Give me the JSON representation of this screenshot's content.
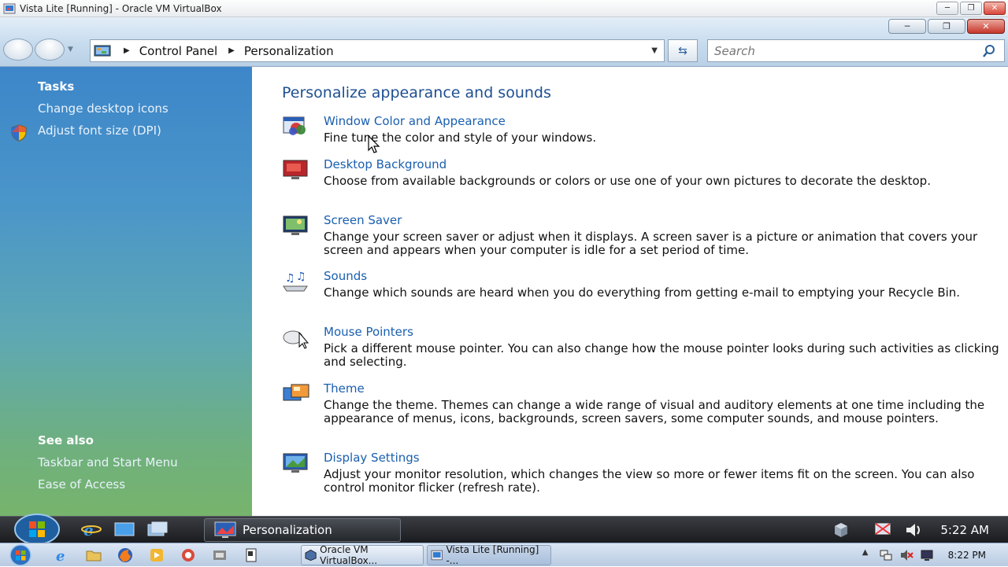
{
  "host": {
    "title": "Vista Lite [Running] - Oracle VM VirtualBox",
    "buttons": [
      "minimize",
      "restore",
      "close"
    ]
  },
  "toolbar": {
    "breadcrumb": [
      "Control Panel",
      "Personalization"
    ],
    "search_placeholder": "Search"
  },
  "sidebar": {
    "tasks_heading": "Tasks",
    "tasks": [
      {
        "label": "Change desktop icons"
      },
      {
        "label": "Adjust font size (DPI)"
      }
    ],
    "see_also_heading": "See also",
    "see_also": [
      {
        "label": "Taskbar and Start Menu"
      },
      {
        "label": "Ease of Access"
      }
    ]
  },
  "main": {
    "title": "Personalize appearance and sounds",
    "items": [
      {
        "icon": "window-color-icon",
        "title": "Window Color and Appearance",
        "desc": "Fine tune the color and style of your windows."
      },
      {
        "icon": "desktop-background-icon",
        "title": "Desktop Background",
        "desc": "Choose from available backgrounds or colors or use one of your own pictures to decorate the desktop."
      },
      {
        "icon": "screen-saver-icon",
        "title": "Screen Saver",
        "desc": "Change your screen saver or adjust when it displays. A screen saver is a picture or animation that covers your screen and appears when your computer is idle for a set period of time."
      },
      {
        "icon": "sounds-icon",
        "title": "Sounds",
        "desc": "Change which sounds are heard when you do everything from getting e-mail to emptying your Recycle Bin."
      },
      {
        "icon": "mouse-pointers-icon",
        "title": "Mouse Pointers",
        "desc": "Pick a different mouse pointer. You can also change how the mouse pointer looks during such activities as clicking and selecting."
      },
      {
        "icon": "theme-icon",
        "title": "Theme",
        "desc": "Change the theme. Themes can change a wide range of visual and auditory elements at one time including the appearance of menus, icons, backgrounds, screen savers, some computer sounds, and mouse pointers."
      },
      {
        "icon": "display-settings-icon",
        "title": "Display Settings",
        "desc": "Adjust your monitor resolution, which changes the view so more or fewer items fit on the screen. You can also control monitor flicker (refresh rate)."
      }
    ]
  },
  "guest_taskbar": {
    "active_window": "Personalization",
    "clock": "5:22 AM"
  },
  "host_taskbar": {
    "buttons": [
      {
        "label": "Oracle VM VirtualBox..."
      },
      {
        "label": "Vista Lite [Running] -..."
      }
    ],
    "clock": "8:22 PM"
  },
  "colors": {
    "link": "#1a5fb0",
    "title": "#1e4f91",
    "sidebar_top": "#3d86c9",
    "sidebar_bottom": "#77b46c"
  }
}
